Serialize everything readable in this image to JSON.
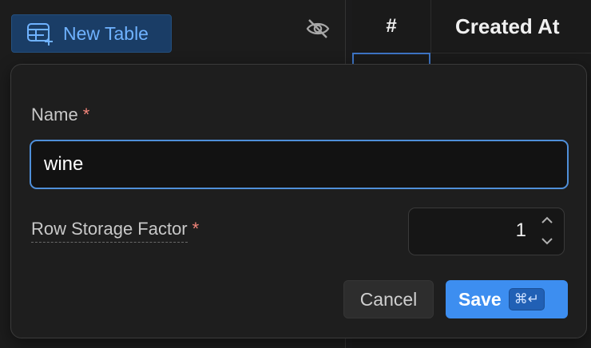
{
  "sidebar": {
    "new_table_label": "New Table",
    "new_table_icon": "table-add-icon",
    "visibility_icon": "eye-off-icon"
  },
  "grid": {
    "columns": [
      "#",
      "Created At"
    ]
  },
  "dialog": {
    "name_label": "Name",
    "name_value": "wine",
    "required_marker": "*",
    "row_storage_label": "Row Storage Factor",
    "row_storage_value": "1",
    "cancel_label": "Cancel",
    "save_label": "Save",
    "save_shortcut": "⌘↵"
  },
  "colors": {
    "accent": "#3d8ef0",
    "required": "#f2857a",
    "new_table_text": "#6fb2ff"
  }
}
